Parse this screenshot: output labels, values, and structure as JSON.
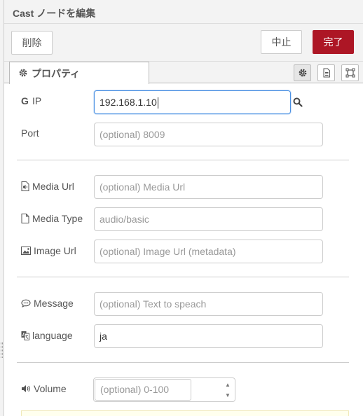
{
  "tray": {
    "title": "Cast ノードを編集"
  },
  "toolbar": {
    "delete_label": "削除",
    "cancel_label": "中止",
    "done_label": "完了"
  },
  "tabs": {
    "properties_label": "プロパティ"
  },
  "form": {
    "ip": {
      "label": "IP",
      "value": "192.168.1.10"
    },
    "port": {
      "label": "Port",
      "placeholder": "(optional) 8009"
    },
    "media_url": {
      "label": "Media Url",
      "placeholder": "(optional) Media Url"
    },
    "media_type": {
      "label": "Media Type",
      "placeholder": "audio/basic"
    },
    "image_url": {
      "label": "Image Url",
      "placeholder": "(optional) Image Url (metadata)"
    },
    "message": {
      "label": "Message",
      "placeholder": "(optional) Text to speach"
    },
    "language": {
      "label": "language",
      "value": "ja"
    },
    "volume": {
      "label": "Volume",
      "placeholder": "(optional) 0-100"
    }
  },
  "colors": {
    "primary_button": "#ad1625",
    "focus_border": "#4a90e2",
    "tip_background": "#ffffee"
  },
  "icons": {
    "ip": "google-icon",
    "search": "search-icon",
    "media_url": "audio-file-icon",
    "media_type": "file-icon",
    "image_url": "image-icon",
    "message": "comment-icon",
    "language": "language-icon",
    "volume": "volume-icon",
    "tab": "gear-icon"
  }
}
